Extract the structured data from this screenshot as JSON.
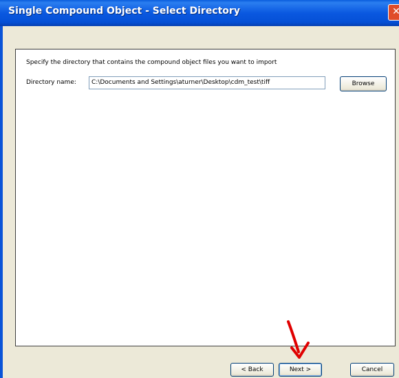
{
  "window": {
    "title": "Single Compound Object - Select Directory",
    "close_glyph": "✕"
  },
  "content": {
    "instruction": "Specify the directory that contains the compound object files you want to import",
    "directory_label": "Directory name:",
    "directory_value": "C:\\Documents and Settings\\aturner\\Desktop\\cdm_test\\tiff",
    "browse_label": "Browse"
  },
  "footer": {
    "back_label": "< Back",
    "next_label": "Next >",
    "cancel_label": "Cancel"
  },
  "annotation": {
    "icon": "red-arrow-icon",
    "color": "#e00000"
  }
}
